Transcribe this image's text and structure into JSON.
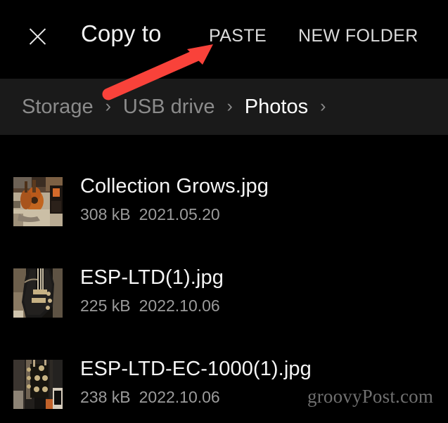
{
  "header": {
    "close_icon": "close-icon",
    "title": "Copy to",
    "actions": [
      {
        "label": "PASTE",
        "name": "paste-button"
      },
      {
        "label": "NEW FOLDER",
        "name": "new-folder-button"
      }
    ]
  },
  "breadcrumb": {
    "separator": "›",
    "items": [
      {
        "label": "Storage",
        "current": false
      },
      {
        "label": "USB drive",
        "current": false
      },
      {
        "label": "Photos",
        "current": true
      }
    ]
  },
  "files": [
    {
      "name": "Collection Grows.jpg",
      "size": "308 kB",
      "date": "2021.05.20",
      "thumbnail": "acoustic-guitars-on-floor"
    },
    {
      "name": "ESP-LTD(1).jpg",
      "size": "225 kB",
      "date": "2022.10.06",
      "thumbnail": "black-electric-guitar"
    },
    {
      "name": "ESP-LTD-EC-1000(1).jpg",
      "size": "238 kB",
      "date": "2022.10.06",
      "thumbnail": "guitar-body-closeup"
    }
  ],
  "annotation": {
    "type": "arrow",
    "color": "#f9423a",
    "points_to": "PASTE"
  },
  "watermark": "groovyPost.com",
  "colors": {
    "background": "#000000",
    "breadcrumb_background": "#1a1a1a",
    "primary_text": "#f5f5f5",
    "secondary_text": "#9b9b9b",
    "muted_text": "#8b8b8b",
    "accent_red": "#f9423a"
  }
}
